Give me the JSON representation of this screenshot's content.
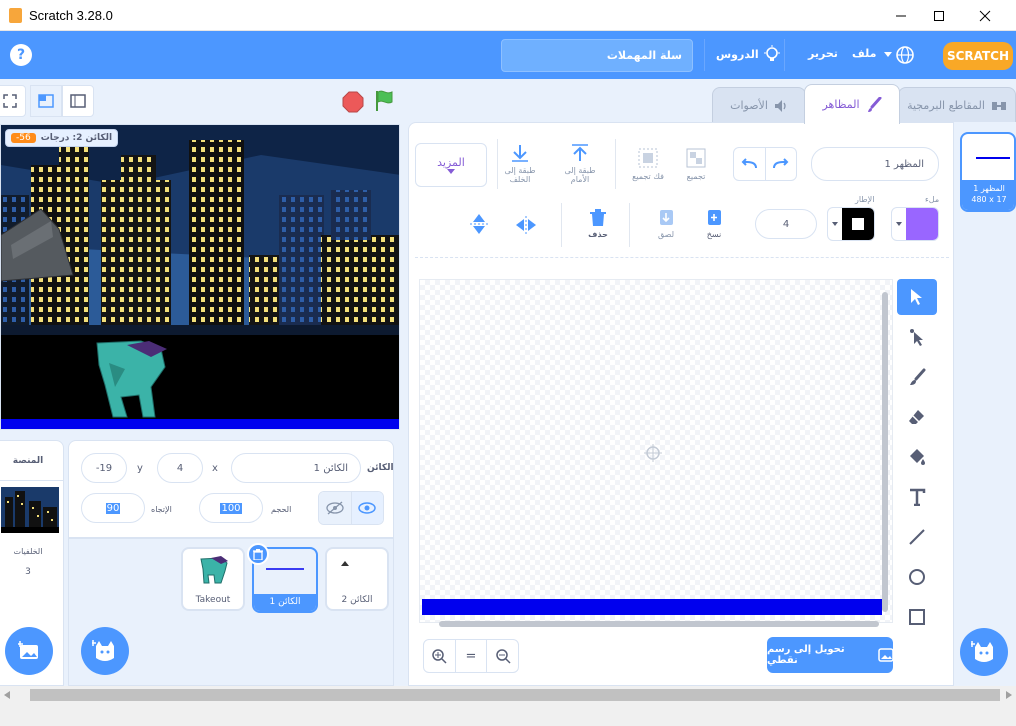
{
  "window": {
    "title": "Scratch 3.28.0",
    "controls": {
      "minimize": "—",
      "maximize": "☐",
      "close": "✕"
    }
  },
  "menubar": {
    "help_glyph": "?",
    "project_title": "سلة المهملات",
    "tutorials_label": "الدروس",
    "edit_label": "تحرير",
    "file_label": "ملف",
    "logo_text": "SCRATCH"
  },
  "tabs": {
    "code": "المقاطع البرمجية",
    "costumes": "المظاهر",
    "sounds": "الأصوات"
  },
  "stage": {
    "monitor_label": "الكائن 2: درجات",
    "monitor_value": "-56"
  },
  "paint": {
    "costume_name": "المظهر 1",
    "group_label": "تجميع",
    "ungroup_label": "فك تجميع",
    "forward_label": "طبقة إلى الأمام",
    "backward_label": "طبقة إلى الخلف",
    "more_label": "المزيد",
    "fill_label": "ملء",
    "outline_label": "الإطار",
    "outline_width": "4",
    "copy_label": "نسخ",
    "paste_label": "لصق",
    "delete_label": "حذف",
    "convert_button": "تحويل إلى رسم نقطي",
    "zoom_reset": "=",
    "fill_color": "#9966ff",
    "line_color": "#0000ee"
  },
  "costume_list": {
    "name": "المظهر 1",
    "size": "480 x 17"
  },
  "sprite_info": {
    "sprite_label": "الكائن",
    "sprite_name": "الكائن 1",
    "x_label": "x",
    "x_value": "4",
    "y_label": "y",
    "y_value": "-19",
    "show_label": "إظهار",
    "size_label": "الحجم",
    "size_value": "100",
    "direction_label": "الإتجاه",
    "direction_value": "90"
  },
  "sprites": [
    {
      "name": "Takeout"
    },
    {
      "name": "الكائن 1"
    },
    {
      "name": "الكائن 2"
    }
  ],
  "stage_panel": {
    "title": "المنصة",
    "backdrops_label": "الخلفيات",
    "backdrops_count": "3"
  }
}
